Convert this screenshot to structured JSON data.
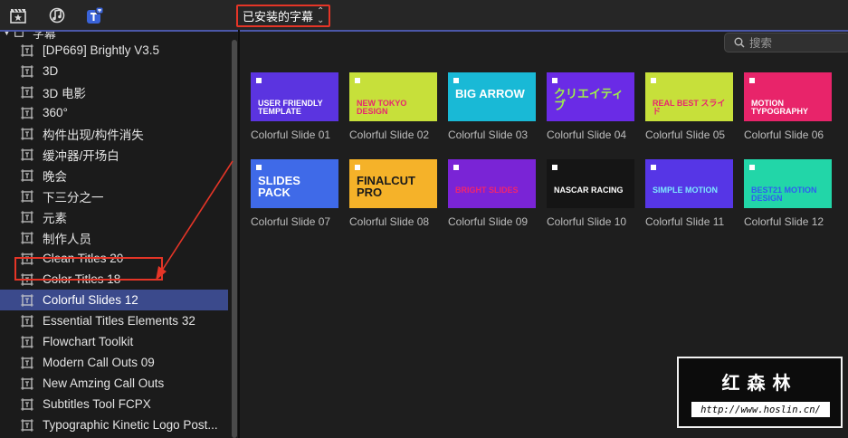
{
  "toolbar": {
    "icons": [
      "clapboard-star-icon",
      "music-note-icon",
      "title-icon"
    ],
    "browser_dropdown": {
      "label": "已安装的字幕",
      "chevron": "up-down-chevron-icon"
    }
  },
  "sidebar": {
    "root": {
      "label": "字幕",
      "expanded": true
    },
    "items": [
      {
        "label": "[DP669] Brightly V3.5"
      },
      {
        "label": "3D"
      },
      {
        "label": "3D 电影"
      },
      {
        "label": "360°"
      },
      {
        "label": "构件出现/构件消失"
      },
      {
        "label": "缓冲器/开场白"
      },
      {
        "label": "晚会"
      },
      {
        "label": "下三分之一"
      },
      {
        "label": "元素"
      },
      {
        "label": "制作人员"
      },
      {
        "label": "Clean Titles 20"
      },
      {
        "label": "Color Titles 18"
      },
      {
        "label": "Colorful Slides 12",
        "selected": true
      },
      {
        "label": "Essential Titles Elements 32"
      },
      {
        "label": "Flowchart Toolkit"
      },
      {
        "label": "Modern Call Outs 09"
      },
      {
        "label": "New Amzing Call Outs"
      },
      {
        "label": "Subtitles Tool FCPX"
      },
      {
        "label": "Typographic Kinetic Logo Post..."
      }
    ]
  },
  "search": {
    "placeholder": "搜索",
    "value": ""
  },
  "tiles": [
    {
      "caption": "Colorful Slide 01",
      "bg": "#5b34e0",
      "text": "USER FRIENDLY TEMPLATE",
      "fg": "#ffffff"
    },
    {
      "caption": "Colorful Slide 02",
      "bg": "#c7e03a",
      "text": "NEW TOKYO DESIGN",
      "fg": "#e8256f"
    },
    {
      "caption": "Colorful Slide 03",
      "bg": "#19b9d6",
      "text": "BIG ARROW",
      "fg": "#ffffff"
    },
    {
      "caption": "Colorful Slide 04",
      "bg": "#6a2be6",
      "text": "クリエイティブ",
      "fg": "#9ef04a"
    },
    {
      "caption": "Colorful Slide 05",
      "bg": "#c7e03a",
      "text": "REAL BEST スライド",
      "fg": "#e8256f"
    },
    {
      "caption": "Colorful Slide 06",
      "bg": "#e8246a",
      "text": "MOTION TYPOGRAPHY",
      "fg": "#ffffff"
    },
    {
      "caption": "Colorful Slide 07",
      "bg": "#3f6ae8",
      "text": "SLIDES PACK",
      "fg": "#ffffff"
    },
    {
      "caption": "Colorful Slide 08",
      "bg": "#f5b229",
      "text": "FINALCUT PRO",
      "fg": "#1a1a1a"
    },
    {
      "caption": "Colorful Slide 09",
      "bg": "#7a24d6",
      "text": "BRIGHT SLIDES",
      "fg": "#f0256e"
    },
    {
      "caption": "Colorful Slide 10",
      "bg": "#151515",
      "text": "NASCAR RACING",
      "fg": "#ffffff"
    },
    {
      "caption": "Colorful Slide 11",
      "bg": "#5636e6",
      "text": "SIMPLE MOTION",
      "fg": "#7de8ff"
    },
    {
      "caption": "Colorful Slide 12",
      "bg": "#22d6a8",
      "text": "BEST21 MOTION DESIGN",
      "fg": "#2f5cf0"
    }
  ],
  "watermark": {
    "title": "红森林",
    "url": "http://www.hoslin.cn/"
  },
  "colors": {
    "accent": "#3b4a8c",
    "highlight_box": "#e53527"
  }
}
